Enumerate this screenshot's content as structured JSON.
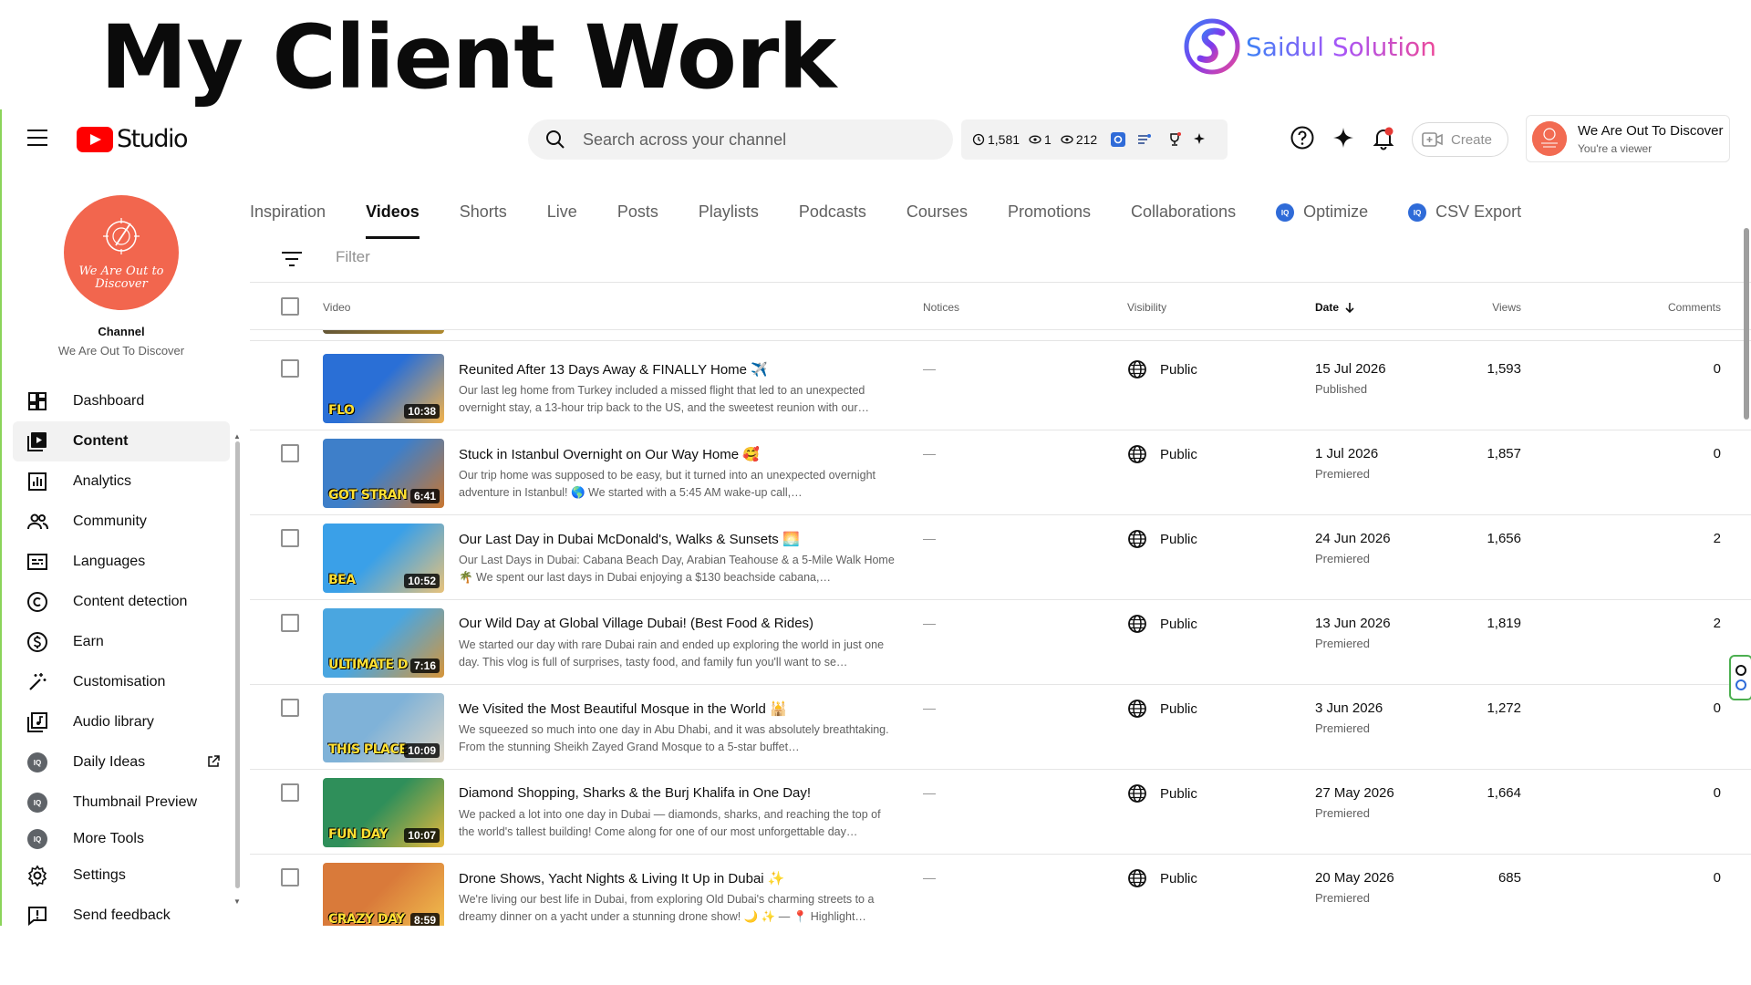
{
  "banner": {
    "title": "My Client Work",
    "brand_name": "Saidul Solution"
  },
  "header": {
    "app_name": "Studio",
    "search_placeholder": "Search across your channel",
    "stats": {
      "watch": "1,581",
      "live_viewers": "1",
      "views": "212"
    },
    "create_label": "Create",
    "account_name": "We Are Out To Discover",
    "account_role": "You're a viewer"
  },
  "channel": {
    "label": "Channel",
    "name": "We Are Out To Discover",
    "avatar_text": "We Are Out to Discover"
  },
  "sidebar": {
    "items": [
      {
        "label": "Dashboard",
        "icon": "dashboard-icon"
      },
      {
        "label": "Content",
        "icon": "content-icon",
        "active": true
      },
      {
        "label": "Analytics",
        "icon": "analytics-icon"
      },
      {
        "label": "Community",
        "icon": "community-icon"
      },
      {
        "label": "Languages",
        "icon": "subtitles-icon"
      },
      {
        "label": "Content detection",
        "icon": "copyright-icon"
      },
      {
        "label": "Earn",
        "icon": "dollar-icon"
      },
      {
        "label": "Customisation",
        "icon": "magic-wand-icon"
      },
      {
        "label": "Audio library",
        "icon": "audio-library-icon"
      },
      {
        "label": "Daily Ideas",
        "icon": "iq-icon",
        "external": true
      },
      {
        "label": "Thumbnail Preview",
        "icon": "iq-icon"
      },
      {
        "label": "More Tools",
        "icon": "iq-icon"
      },
      {
        "label": "Settings",
        "icon": "gear-icon"
      },
      {
        "label": "Send feedback",
        "icon": "feedback-icon"
      }
    ]
  },
  "tabs": [
    {
      "label": "Inspiration"
    },
    {
      "label": "Videos",
      "active": true
    },
    {
      "label": "Shorts"
    },
    {
      "label": "Live"
    },
    {
      "label": "Posts"
    },
    {
      "label": "Playlists"
    },
    {
      "label": "Podcasts"
    },
    {
      "label": "Courses"
    },
    {
      "label": "Promotions"
    },
    {
      "label": "Collaborations"
    },
    {
      "label": "Optimize",
      "iq": true
    },
    {
      "label": "CSV Export",
      "iq": true
    }
  ],
  "filter": {
    "placeholder": "Filter"
  },
  "table": {
    "headers": {
      "video": "Video",
      "notices": "Notices",
      "visibility": "Visibility",
      "date": "Date",
      "views": "Views",
      "comments": "Comments"
    },
    "rows": [
      {
        "title": "Reunited After 13 Days Away & FINALLY Home ✈️",
        "description": "Our last leg home from Turkey included a missed flight that led to an unexpected overnight stay, a 13-hour trip back to the US, and the sweetest reunion with our…",
        "thumb_text": "FLO",
        "duration": "10:38",
        "notice": "—",
        "visibility": "Public",
        "date": "15 Jul 2026",
        "status": "Published",
        "views": "1,593",
        "comments": "0",
        "thumb_colors": [
          "#2a6fd6",
          "#f3b24a"
        ]
      },
      {
        "title": "Stuck in Istanbul Overnight on Our Way Home 🥰",
        "description": "Our trip home was supposed to be easy, but it turned into an unexpected overnight adventure in Istanbul! 🌎 We started with a 5:45 AM wake-up call,…",
        "thumb_text": "GOT STRAN",
        "duration": "6:41",
        "notice": "—",
        "visibility": "Public",
        "date": "1 Jul 2026",
        "status": "Premiered",
        "views": "1,857",
        "comments": "0",
        "thumb_colors": [
          "#3e7fc9",
          "#c9762f"
        ]
      },
      {
        "title": "Our Last Day in Dubai McDonald's, Walks & Sunsets 🌅",
        "description": "Our Last Days in Dubai: Cabana Beach Day, Arabian Teahouse & a 5-Mile Walk Home 🌴 We spent our last days in Dubai enjoying a $130 beachside cabana,…",
        "thumb_text": "BEA",
        "duration": "10:52",
        "notice": "—",
        "visibility": "Public",
        "date": "24 Jun 2026",
        "status": "Premiered",
        "views": "1,656",
        "comments": "2",
        "thumb_colors": [
          "#3aa0e8",
          "#e8c27a"
        ]
      },
      {
        "title": "Our Wild Day at Global Village Dubai! (Best Food & Rides)",
        "description": "We started our day with rare Dubai rain and ended up exploring the world in just one day. This vlog is full of surprises, tasty food, and family fun you'll want to se…",
        "thumb_text": "ULTIMATE D",
        "duration": "7:16",
        "notice": "—",
        "visibility": "Public",
        "date": "13 Jun 2026",
        "status": "Premiered",
        "views": "1,819",
        "comments": "2",
        "thumb_colors": [
          "#4aa6e0",
          "#d6953a"
        ]
      },
      {
        "title": "We Visited the Most Beautiful Mosque in the World 🕌",
        "description": "We squeezed so much into one day in Abu Dhabi, and it was absolutely breathtaking. From the stunning Sheikh Zayed Grand Mosque to a 5-star buffet…",
        "thumb_text": "THIS PLACE",
        "duration": "10:09",
        "notice": "—",
        "visibility": "Public",
        "date": "3 Jun 2026",
        "status": "Premiered",
        "views": "1,272",
        "comments": "0",
        "thumb_colors": [
          "#7fb2d8",
          "#e0d6c4"
        ]
      },
      {
        "title": "Diamond Shopping, Sharks & the Burj Khalifa in One Day!",
        "description": "We packed a lot into one day in Dubai — diamonds, sharks, and reaching the top of the world's tallest building! Come along for one of our most unforgettable day…",
        "thumb_text": "FUN DAY",
        "duration": "10:07",
        "notice": "—",
        "visibility": "Public",
        "date": "27 May 2026",
        "status": "Premiered",
        "views": "1,664",
        "comments": "0",
        "thumb_colors": [
          "#2f8f5a",
          "#e6b83d"
        ]
      },
      {
        "title": "Drone Shows, Yacht Nights & Living It Up in Dubai ✨",
        "description": "We're living our best life in Dubai, from exploring Old Dubai's charming streets to a dreamy dinner on a yacht under a stunning drone show! 🌙 ✨ — 📍 Highlight…",
        "thumb_text": "CRAZY DAY",
        "duration": "8:59",
        "notice": "—",
        "visibility": "Public",
        "date": "20 May 2026",
        "status": "Premiered",
        "views": "685",
        "comments": "0",
        "thumb_colors": [
          "#d97a3a",
          "#f2c14e"
        ]
      }
    ]
  }
}
